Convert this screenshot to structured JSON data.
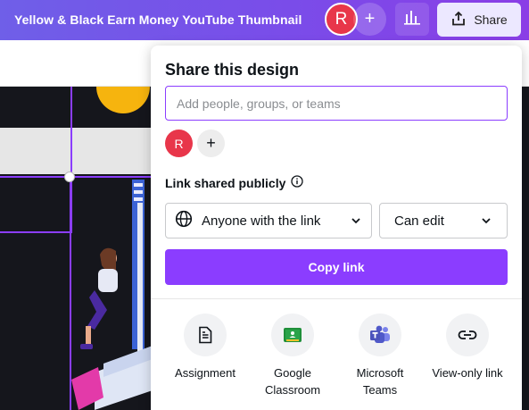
{
  "header": {
    "doc_title": "Yellow & Black Earn Money YouTube Thumbnail",
    "avatar_initial": "R",
    "add_label": "+",
    "share_label": "Share"
  },
  "share_panel": {
    "title": "Share this design",
    "people_input": {
      "value": "",
      "placeholder": "Add people, groups, or teams"
    },
    "collaborator_initial": "R",
    "add_collaborator_label": "+",
    "link_label": "Link shared publicly",
    "access_value": "Anyone with the link",
    "permission_value": "Can edit",
    "copy_button": "Copy link",
    "options": [
      {
        "label": "Assignment",
        "icon": "assignment-icon"
      },
      {
        "label": "Google Classroom",
        "icon": "google-classroom-icon"
      },
      {
        "label": "Microsoft Teams",
        "icon": "microsoft-teams-icon"
      },
      {
        "label": "View-only link",
        "icon": "link-icon"
      }
    ]
  },
  "colors": {
    "brand_purple": "#8b3dff",
    "avatar_red": "#e8364a",
    "header_gradient_start": "#6f5fe8",
    "header_gradient_end": "#8a3ee6",
    "canvas_bg": "#15161c"
  }
}
